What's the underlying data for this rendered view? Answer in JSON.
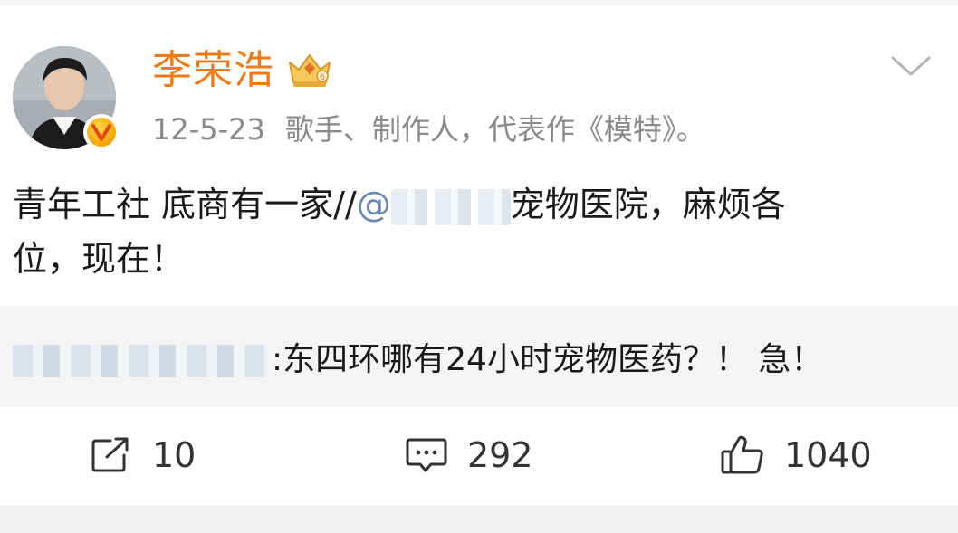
{
  "header": {
    "username": "李荣浩",
    "timestamp": "12-5-23",
    "bio": "歌手、制作人，代表作《模特》。",
    "avatar_icon": "avatar-photo",
    "badge_icon": "verified-v-icon",
    "crown_icon": "crown-level-icon",
    "menu_icon": "chevron-down-icon"
  },
  "post": {
    "line1_start": "青年工社 底商有一家//",
    "mention_prefix": "@",
    "line1_end": "宠物医院，麻烦各",
    "line2": "位，现在！"
  },
  "repost": {
    "text": ":东四环哪有24小时宠物医药？！ 急！"
  },
  "actions": {
    "repost_count": "10",
    "comment_count": "292",
    "like_count": "1040"
  },
  "colors": {
    "username": "#f07a18",
    "meta": "#8a8a8a",
    "text": "#1a1a1a",
    "repost_bg": "#f5f5f5"
  }
}
